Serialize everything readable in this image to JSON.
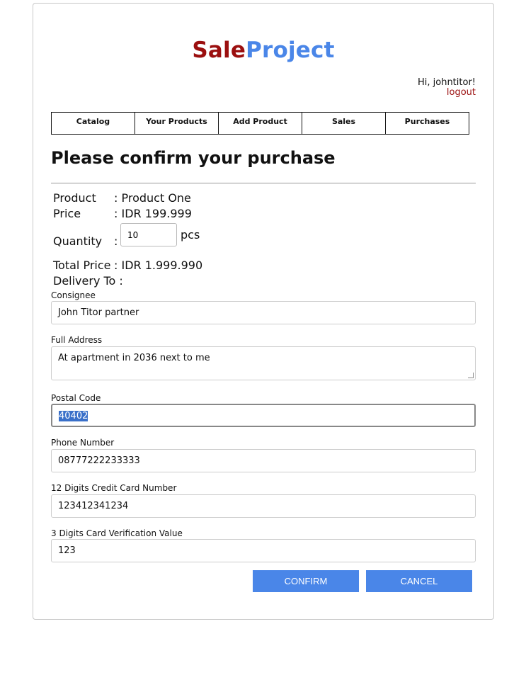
{
  "brand": {
    "part1": "Sale",
    "part2": "Project"
  },
  "user": {
    "greeting": "Hi, johntitor!",
    "logout": "logout"
  },
  "nav": [
    {
      "label": "Catalog"
    },
    {
      "label": "Your Products"
    },
    {
      "label": "Add Product"
    },
    {
      "label": "Sales"
    },
    {
      "label": "Purchases"
    }
  ],
  "heading": "Please confirm your purchase",
  "summary": {
    "product_label": "Product",
    "product_value": ": Product One",
    "price_label": "Price",
    "price_value": ": IDR 199.999",
    "quantity_label": "Quantity",
    "quantity_colon": ":",
    "quantity_value": "10",
    "quantity_unit": "pcs",
    "total_label": "Total Price",
    "total_value": ": IDR 1.999.990",
    "delivery_label": "Delivery To :"
  },
  "form": {
    "consignee_label": "Consignee",
    "consignee_value": "John Titor partner",
    "address_label": "Full Address",
    "address_value": "At apartment in 2036 next to me",
    "postal_label": "Postal Code",
    "postal_value": "40402",
    "phone_label": "Phone Number",
    "phone_value": "08777222233333",
    "card_label": "12 Digits Credit Card Number",
    "card_value": "123412341234",
    "cvv_label": "3 Digits Card Verification Value",
    "cvv_value": "123"
  },
  "buttons": {
    "confirm": "CONFIRM",
    "cancel": "CANCEL"
  },
  "colors": {
    "brand_red": "#9b0f0f",
    "brand_blue": "#4a86e8",
    "button": "#4a86e8"
  }
}
